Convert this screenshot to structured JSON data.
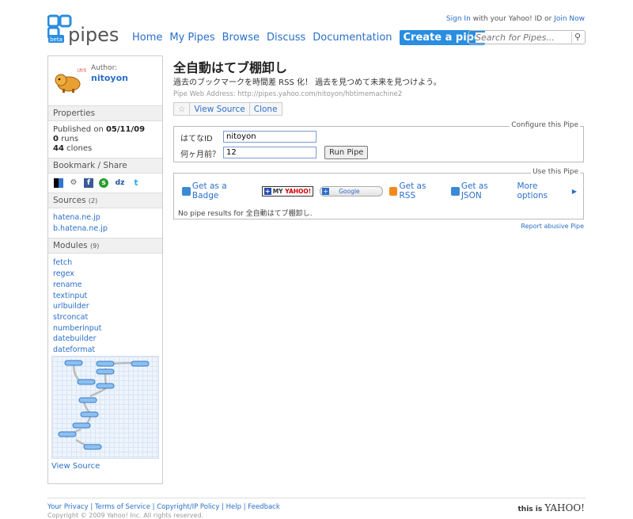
{
  "header": {
    "logo_text": "pipes",
    "logo_badge": "beta",
    "nav": [
      "Home",
      "My Pipes",
      "Browse",
      "Discuss",
      "Documentation"
    ],
    "create_label": "Create a pipe",
    "signin_link": "Sign In",
    "signin_text": " with your Yahoo! ID or ",
    "join_link": "Join Now",
    "search_placeholder": "Search for Pipes..."
  },
  "sidebar": {
    "author_label": "Author:",
    "author_name": "nitoyon",
    "properties_title": "Properties",
    "published_label": "Published on ",
    "published_date": "05/11/09",
    "runs_count": "0",
    "runs_label": " runs",
    "clones_count": "44",
    "clones_label": " clones",
    "bookmark_title": "Bookmark / Share",
    "sources_title": "Sources",
    "sources_count": "(2)",
    "sources": [
      "hatena.ne.jp",
      "b.hatena.ne.jp"
    ],
    "modules_title": "Modules",
    "modules_count": "(9)",
    "modules": [
      "fetch",
      "regex",
      "rename",
      "textinput",
      "urlbuilder",
      "strconcat",
      "numberinput",
      "datebuilder",
      "dateformat"
    ],
    "view_source": "View Source"
  },
  "pipe": {
    "title": "全自動はてブ棚卸し",
    "description": "過去のブックマークを時間差 RSS 化！ 過去を見つめて未来を見つけよう。",
    "address_label": "Pipe Web Address: ",
    "address": "http://pipes.yahoo.com/nitoyon/hbtimemachine2",
    "star": "☆",
    "view_source": "View Source",
    "clone": "Clone"
  },
  "configure": {
    "legend": "Configure this Pipe",
    "field1_label": "はてなID",
    "field1_value": "nitoyon",
    "field2_label": "何ヶ月前？",
    "field2_value": "12",
    "run_button": "Run Pipe"
  },
  "use": {
    "legend": "Use this Pipe",
    "badge": "Get as a Badge",
    "myyahoo_my": "MY",
    "myyahoo_y": "YAHOO!",
    "google": "Google",
    "rss": "Get as RSS",
    "json": "Get as JSON",
    "more": "More options",
    "no_results_prefix": "No pipe results for ",
    "no_results_name": "全自動はてブ棚卸し",
    "no_results_suffix": "."
  },
  "report": "Report abusive Pipe",
  "footer": {
    "links": "Your Privacy | Terms of Service | Copyright/IP Policy | Help | Feedback",
    "copyright": "Copyright © 2009 Yahoo! Inc. All rights reserved.",
    "this_is": "this is ",
    "yahoo": "YAHOO!"
  },
  "colors": {
    "link": "#2a6fc9",
    "create_bg": "#2a8de0",
    "rss": "#f48a1c"
  }
}
